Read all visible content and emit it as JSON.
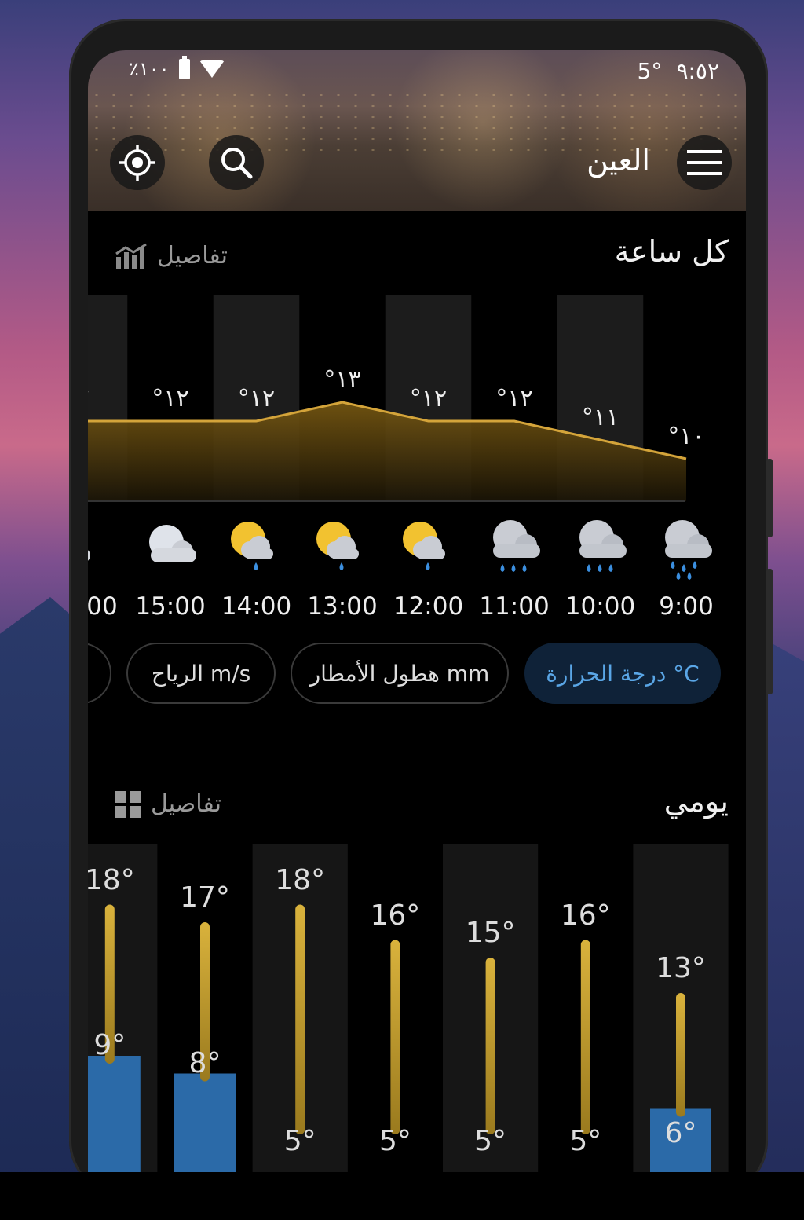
{
  "status": {
    "time": "٩:٥٢",
    "temp": "5°",
    "battery": "٪١٠٠"
  },
  "header": {
    "city": "العين"
  },
  "hourly": {
    "title": "كل ساعة",
    "details": "تفاصيل",
    "chips": [
      "درجة الحرارة °C",
      "هطول الأمطار mm",
      "الرياح m/s"
    ]
  },
  "daily": {
    "title": "يومي",
    "details": "تفاصيل"
  },
  "icons": [
    "locate-icon",
    "search-icon",
    "menu-icon",
    "chart-icon",
    "grid-icon"
  ],
  "colors": {
    "accent": "#d4a43a",
    "active": "#5aa6e6",
    "rain_bar": "#2b6aa8"
  },
  "chart_data": [
    {
      "type": "area",
      "x": [
        "9:00",
        "10:00",
        "11:00",
        "12:00",
        "13:00",
        "14:00",
        "15:00"
      ],
      "y": [
        10,
        11,
        12,
        12,
        13,
        12,
        12
      ],
      "labels": [
        "°١٠",
        "°١١",
        "°١٢",
        "°١٢",
        "°١٣",
        "°١٢",
        "°١٢"
      ],
      "weather": [
        "heavy-rain",
        "rain",
        "rain",
        "sun-showers",
        "sun-showers",
        "sun-showers",
        "cloudy"
      ]
    },
    {
      "type": "bar",
      "highs": [
        13,
        16,
        15,
        16,
        18,
        17,
        18
      ],
      "lows": [
        6,
        5,
        5,
        5,
        5,
        8,
        9
      ],
      "high_labels": [
        "13°",
        "16°",
        "15°",
        "16°",
        "18°",
        "17°",
        "18°"
      ],
      "low_labels": [
        "6°",
        "5°",
        "5°",
        "5°",
        "5°",
        "8°",
        "9°"
      ],
      "precipitation_flags": [
        true,
        false,
        false,
        false,
        false,
        true,
        true
      ]
    }
  ]
}
